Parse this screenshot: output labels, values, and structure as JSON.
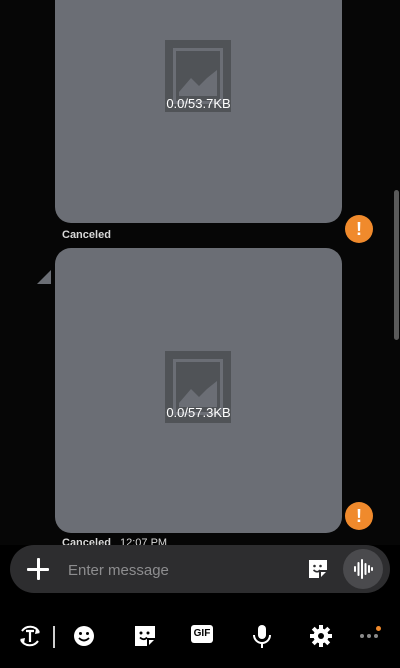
{
  "messages": [
    {
      "size_text": "0.0/53.7KB",
      "status": "Canceled",
      "error_icon": "!"
    },
    {
      "size_text": "0.0/57.3KB",
      "status": "Canceled",
      "time": "12:07 PM",
      "error_icon": "!"
    }
  ],
  "composer": {
    "placeholder": "Enter message",
    "attach_icon": "plus-icon",
    "sticker_icon": "sticker-icon",
    "voice_icon": "voice-wave-icon"
  },
  "toolbar": {
    "items": [
      "translate-icon",
      "emoji-icon",
      "sticker-icon",
      "gif-icon",
      "microphone-icon",
      "settings-icon",
      "more-icon"
    ],
    "gif_label": "GIF"
  },
  "colors": {
    "bubble": "#6b6e75",
    "error_badge": "#f08a2c",
    "composer_bg": "#2d2d2f",
    "background": "#000000"
  }
}
